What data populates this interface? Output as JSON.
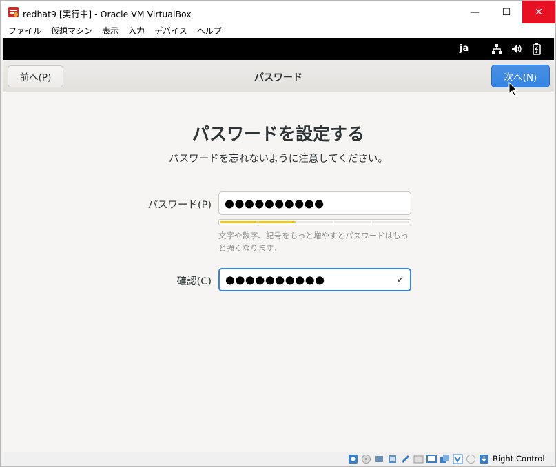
{
  "window": {
    "title": "redhat9 [実行中] - Oracle VM VirtualBox",
    "min_glyph": "—",
    "max_glyph": "☐",
    "close_glyph": "✕"
  },
  "menu": {
    "items": [
      "ファイル",
      "仮想マシン",
      "表示",
      "入力",
      "デバイス",
      "ヘルプ"
    ]
  },
  "guest_topbar": {
    "language": "ja",
    "icons": [
      "network-icon",
      "volume-icon",
      "battery-icon"
    ]
  },
  "header": {
    "back_label": "前へ(P)",
    "title": "パスワード",
    "next_label": "次へ(N)"
  },
  "main": {
    "title": "パスワードを設定する",
    "subtitle": "パスワードを忘れないように注意してください。",
    "password_label": "パスワード(P)",
    "password_value": "●●●●●●●●●●",
    "strength_level": 0.4,
    "strength_hint": "文字や数字、記号をもっと増やすとパスワードはもっと強くなります。",
    "confirm_label": "確認(C)",
    "confirm_value": "●●●●●●●●●●",
    "confirm_check": "✔"
  },
  "statusbar": {
    "host_key": "Right Control"
  },
  "colors": {
    "accent": "#3584e4",
    "strength": "#f5c211",
    "close": "#e81123"
  }
}
